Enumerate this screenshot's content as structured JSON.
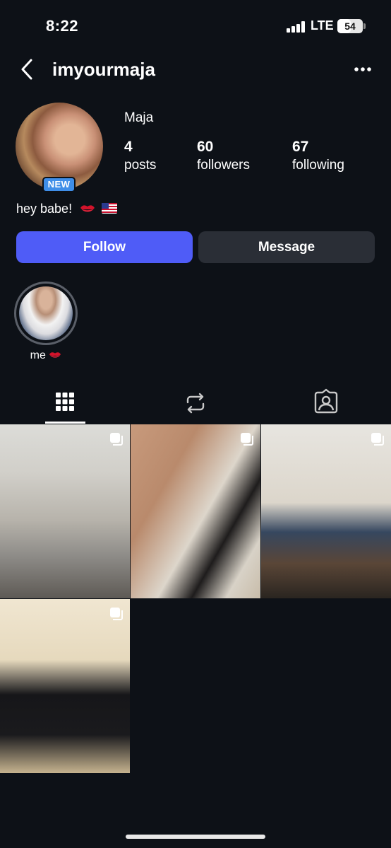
{
  "status": {
    "time": "8:22",
    "network": "LTE",
    "battery": "54",
    "battery_level": 0.54
  },
  "header": {
    "username": "imyourmaja",
    "back_icon": "back-arrow-icon",
    "more_icon": "more-options-icon"
  },
  "profile": {
    "display_name": "Maja",
    "badge": "NEW",
    "stats": [
      {
        "value": "4",
        "label": "posts"
      },
      {
        "value": "60",
        "label": "followers"
      },
      {
        "value": "67",
        "label": "following"
      }
    ],
    "bio": "hey babe!"
  },
  "actions": {
    "follow_label": "Follow",
    "message_label": "Message",
    "follow_color": "#4f5cf7",
    "message_color": "#2a2e36"
  },
  "highlights": [
    {
      "label": "me"
    }
  ],
  "tabs": [
    {
      "name": "posts-grid",
      "icon": "grid-icon",
      "active": true
    },
    {
      "name": "reposts",
      "icon": "repost-icon",
      "active": false
    },
    {
      "name": "tagged",
      "icon": "tagged-person-icon",
      "active": false
    }
  ],
  "posts": [
    {
      "type": "multi"
    },
    {
      "type": "multi"
    },
    {
      "type": "multi"
    },
    {
      "type": "multi"
    }
  ]
}
